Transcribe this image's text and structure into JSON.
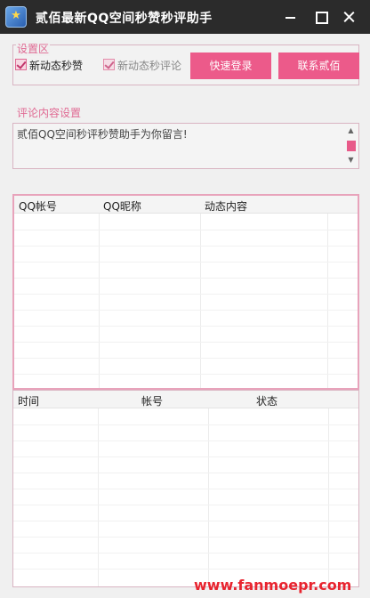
{
  "window": {
    "title": "贰佰最新QQ空间秒赞秒评助手",
    "icon": "app-icon"
  },
  "settings": {
    "label": "设置区",
    "checkbox_like": {
      "label": "新动态秒赞",
      "checked": true
    },
    "checkbox_comment": {
      "label": "新动态秒评论",
      "checked": true
    },
    "login_button": "快速登录",
    "contact_button": "联系贰佰"
  },
  "comment": {
    "label": "评论内容设置",
    "text": "贰佰QQ空间秒评秒赞助手为你留言!"
  },
  "table_dynamics": {
    "columns": [
      "QQ帐号",
      "QQ昵称",
      "动态内容"
    ],
    "rows": []
  },
  "table_log": {
    "columns": [
      "时间",
      "帐号",
      "状态"
    ],
    "rows": []
  },
  "watermark": "www.fanmoepr.com",
  "colors": {
    "accent": "#ec5a8a",
    "titlebar": "#2b2b2b",
    "border": "#d9b4c2"
  }
}
